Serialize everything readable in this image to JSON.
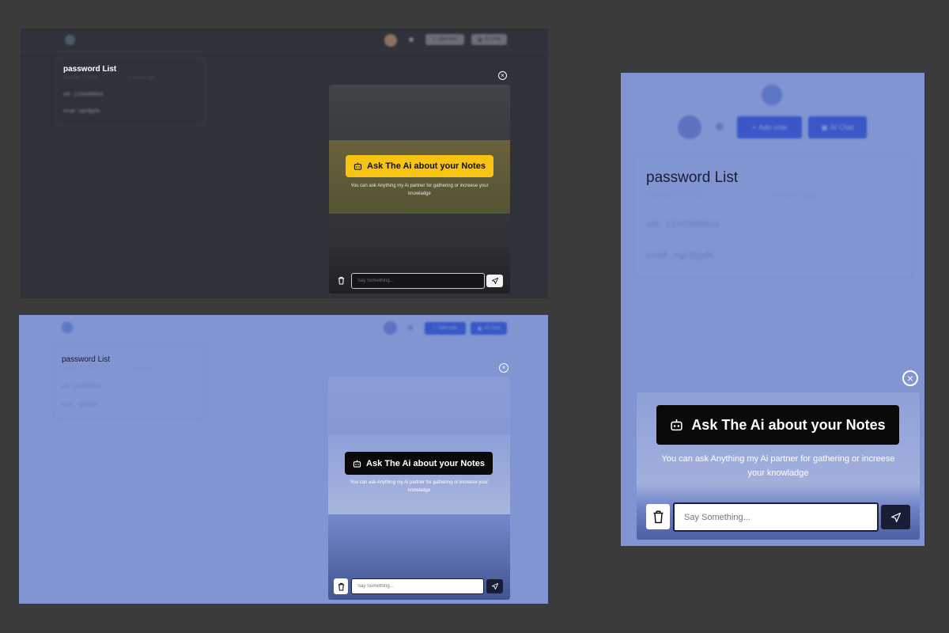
{
  "icons": {
    "bot": "robot-icon",
    "trash": "trash-icon",
    "send": "send-icon",
    "close": "close-circle-icon",
    "plus": "plus-icon",
    "chat": "chat-icon"
  },
  "colors": {
    "dark_bg": "#2f3339",
    "light_bg": "#8095d2",
    "ask_yellow": "#f7c414",
    "ask_dark": "#0a0a0a",
    "accent_blue": "#3957c6"
  },
  "header": {
    "add_note": "Add note",
    "ai_chat": "AI Chat"
  },
  "note": {
    "title": "password List",
    "date": "Warmbi 27 2024",
    "ago": "a month ago",
    "line1": "wifi : 12345999934",
    "line2": "email : ngkdfjgdfs"
  },
  "chat": {
    "ask_label": "Ask The Ai about your Notes",
    "description": "You can ask Anything my Ai partner for gathering or increese your knowladge",
    "input_placeholder": "Say Something..."
  }
}
